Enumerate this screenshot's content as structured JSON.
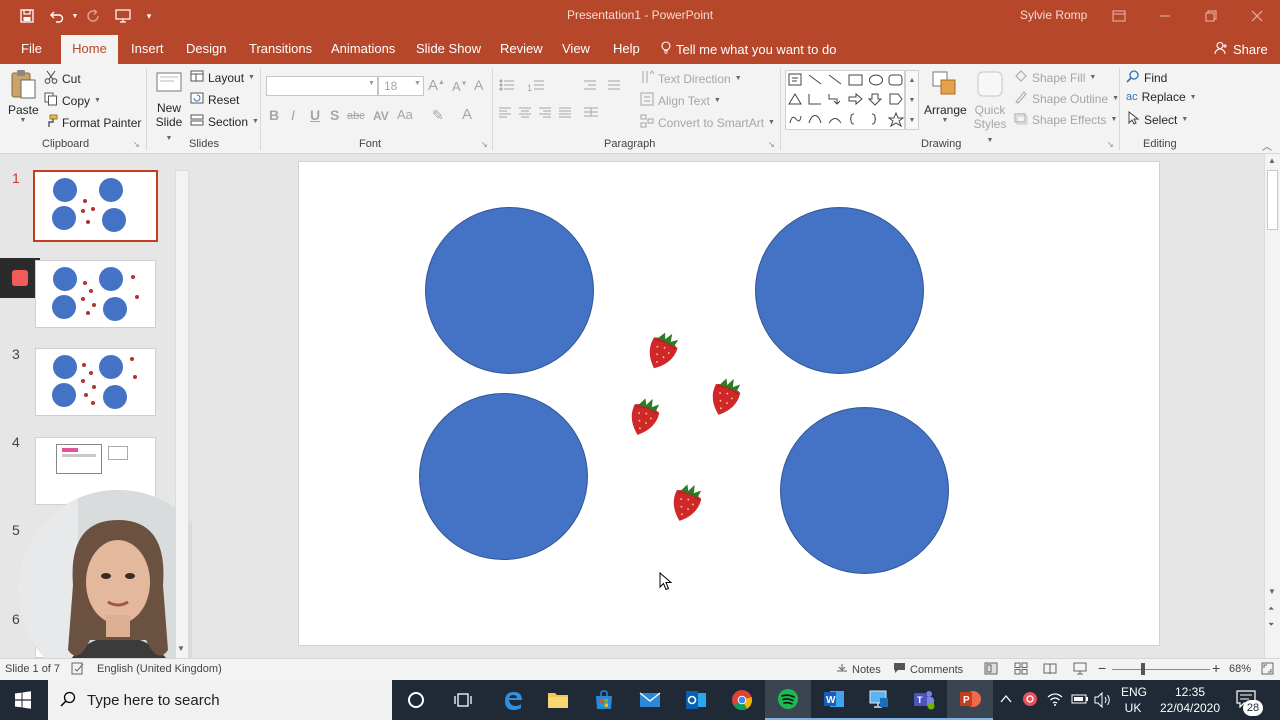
{
  "titlebar": {
    "doc_title": "Presentation1  -  PowerPoint",
    "user": "Sylvie Romp"
  },
  "tabs": [
    "File",
    "Home",
    "Insert",
    "Design",
    "Transitions",
    "Animations",
    "Slide Show",
    "Review",
    "View",
    "Help"
  ],
  "tell_me": "Tell me what you want to do",
  "share": "Share",
  "ribbon": {
    "clipboard": {
      "paste": "Paste",
      "cut": "Cut",
      "copy": "Copy",
      "format_painter": "Format Painter",
      "label": "Clipboard"
    },
    "slides": {
      "new_slide_1": "New",
      "new_slide_2": "Slide",
      "layout": "Layout",
      "reset": "Reset",
      "section": "Section",
      "label": "Slides"
    },
    "font": {
      "font_name": "",
      "font_size": "18",
      "label": "Font",
      "bold": "B",
      "italic": "I",
      "underline": "U",
      "shadow": "S",
      "strike": "abc",
      "spacing": "AV",
      "case": "Aa"
    },
    "paragraph": {
      "text_direction": "Text Direction",
      "align_text": "Align Text",
      "convert_smartart": "Convert to SmartArt",
      "label": "Paragraph"
    },
    "drawing": {
      "arrange": "Arrange",
      "quick_styles_1": "Quick",
      "quick_styles_2": "Styles",
      "shape_fill": "Shape Fill",
      "shape_outline": "Shape Outline",
      "shape_effects": "Shape Effects",
      "label": "Drawing"
    },
    "editing": {
      "find": "Find",
      "replace": "Replace",
      "select": "Select",
      "label": "Editing"
    }
  },
  "slides_panel": {
    "numbers": [
      "1",
      "3",
      "4",
      "5",
      "6"
    ]
  },
  "statusbar": {
    "slide_info": "Slide 1 of 7",
    "language": "English (United Kingdom)",
    "notes": "Notes",
    "comments": "Comments",
    "zoom": "68%"
  },
  "taskbar": {
    "search_placeholder": "Type here to search",
    "lang_1": "ENG",
    "lang_2": "UK",
    "time": "12:35",
    "date": "22/04/2020",
    "notif_count": "28"
  },
  "colors": {
    "accent": "#b7472a",
    "circle_fill": "#4472c4",
    "strawberry": "#d0272b"
  }
}
